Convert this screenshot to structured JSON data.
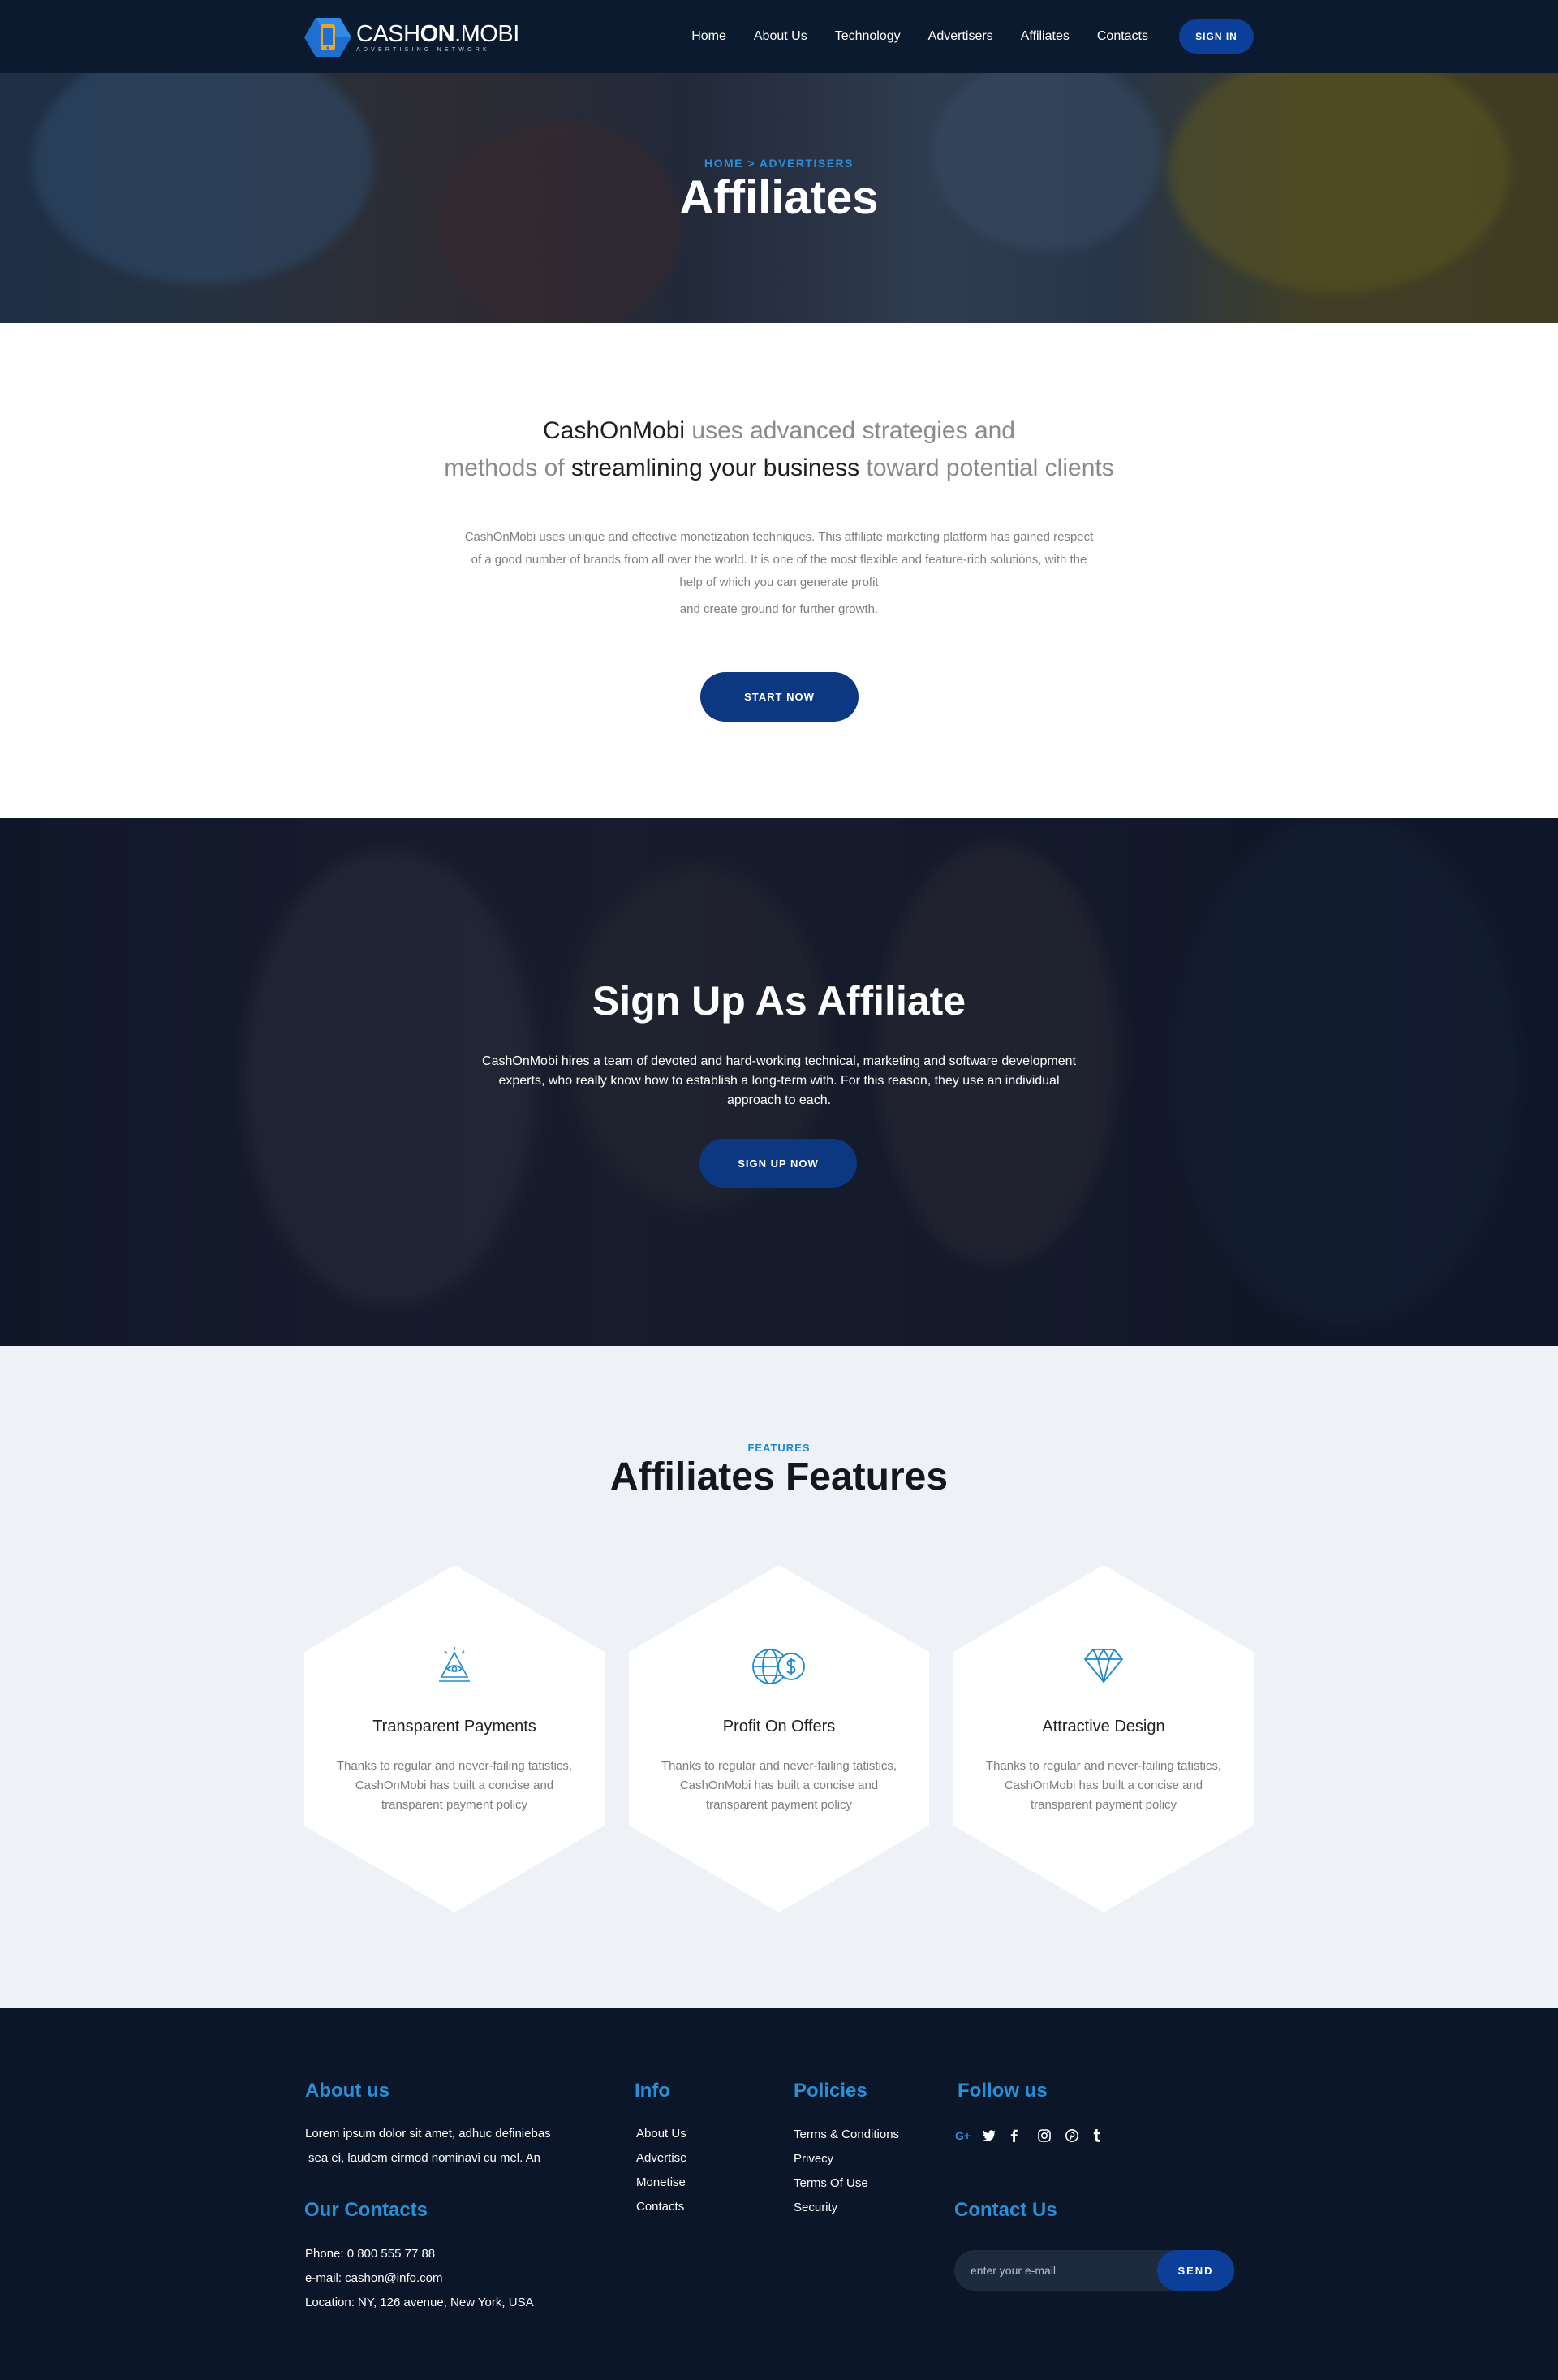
{
  "header": {
    "logo_name_light": "CASH",
    "logo_name_bold": "ON",
    "logo_name_tail": ".MOBI",
    "logo_tagline": "ADVERTISING NETWORK",
    "nav": [
      "Home",
      "About Us",
      "Technology",
      "Advertisers",
      "Affiliates",
      "Contacts"
    ],
    "signin_label": "SIGN IN"
  },
  "hero": {
    "breadcrumb": "HOME > ADVERTISERS",
    "title": "Affiliates"
  },
  "intro": {
    "headline_1_dark": "CashOnMobi",
    "headline_1_light": " uses advanced strategies and",
    "headline_2_light_a": "methods of ",
    "headline_2_dark": "streamlining your business",
    "headline_2_light_b": " toward potential clients",
    "body_1": "CashOnMobi uses unique and effective monetization techniques. This affiliate marketing platform has gained respect of a good number of brands from all over the world. It is one of the most flexible and feature-rich solutions, with the help of which you can generate profit",
    "body_2": "and create ground for further growth.",
    "button_label": "START NOW"
  },
  "signup": {
    "title": "Sign Up As Affiliate",
    "body": "CashOnMobi hires a team of devoted and hard-working technical, marketing and software development experts, who really know how to establish a long-term with. For this reason, they use an individual approach to each.",
    "button_label": "SIGN UP NOW"
  },
  "features": {
    "kicker": "FEATURES",
    "title": "Affiliates Features",
    "items": [
      {
        "icon": "pyramid-eye-icon",
        "title": "Transparent Payments",
        "body": "Thanks to regular and never-failing tatistics, CashOnMobi has built a concise and transparent payment policy"
      },
      {
        "icon": "globe-dollar-icon",
        "title": "Profit On Offers",
        "body": "Thanks to regular and never-failing tatistics, CashOnMobi has built a concise and transparent payment policy"
      },
      {
        "icon": "diamond-icon",
        "title": "Attractive Design",
        "body": "Thanks to regular and never-failing tatistics, CashOnMobi has built a concise and transparent payment policy"
      }
    ]
  },
  "footer": {
    "about_title": "About us",
    "about_line_1": "Lorem ipsum dolor sit amet, adhuc definiebas",
    "about_line_2": "sea ei, laudem eirmod nominavi cu mel. An",
    "contacts_title": "Our Contacts",
    "phone": "Phone: 0 800 555 77 88",
    "email": "e-mail: cashon@info.com",
    "location": "Location: NY, 126 avenue, New York, USA",
    "info_title": "Info",
    "info_links": [
      "About Us",
      "Advertise",
      "Monetise",
      "Contacts"
    ],
    "policies_title": "Policies",
    "policies_links": [
      "Terms & Conditions",
      "Privecy",
      "Terms Of Use",
      "Security"
    ],
    "follow_title": "Follow us",
    "social_icons": [
      "google-plus-icon",
      "twitter-icon",
      "facebook-icon",
      "instagram-icon",
      "pinterest-icon",
      "tumblr-icon"
    ],
    "google_plus_glyph": "G+",
    "contact_title": "Contact Us",
    "email_placeholder": "enter your e-mail",
    "send_label": "SEND"
  },
  "colors": {
    "header_bg": "#0b1a2e",
    "primary_button": "#0b3880",
    "accent_blue": "#2a8fd6",
    "features_bg": "#eef1f5",
    "footer_bg": "#0c1629"
  }
}
